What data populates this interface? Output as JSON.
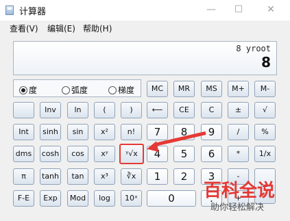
{
  "window": {
    "title": "计算器",
    "minimize_glyph": "—",
    "maximize_glyph": "☐",
    "close_glyph": "✕"
  },
  "menu": [
    "查看(V)",
    "编辑(E)",
    "帮助(H)"
  ],
  "display": {
    "expression": "8 yroot",
    "value": "8"
  },
  "angle_modes": [
    {
      "label": "度",
      "selected": true
    },
    {
      "label": "弧度",
      "selected": false
    },
    {
      "label": "梯度",
      "selected": false
    }
  ],
  "keys": {
    "mc": "MC",
    "mr": "MR",
    "ms": "MS",
    "mplus": "M+",
    "mminus": "M-",
    "inv": "Inv",
    "ln": "ln",
    "lparen": "(",
    "rparen": ")",
    "backspace": "⟵",
    "ce": "CE",
    "c": "C",
    "plusminus": "±",
    "sqrt": "√",
    "int": "Int",
    "sinh": "sinh",
    "sin": "sin",
    "x2": "x²",
    "fact": "n!",
    "seven": "7",
    "eight": "8",
    "nine": "9",
    "divide": "/",
    "percent": "%",
    "dms": "dms",
    "cosh": "cosh",
    "cos": "cos",
    "xy": "xʸ",
    "yroot": "ʸ√x",
    "four": "4",
    "five": "5",
    "six": "6",
    "multiply": "*",
    "reciprocal": "1/x",
    "pi": "π",
    "tanh": "tanh",
    "tan": "tan",
    "x3": "x³",
    "cuberoot": "∛x",
    "one": "1",
    "two": "2",
    "three": "3",
    "minus": "-",
    "equals": "=",
    "fe": "F-E",
    "exp": "Exp",
    "mod": "Mod",
    "log": "log",
    "tenx": "10ˣ",
    "zero": "0",
    "dot": ".",
    "plus": "+"
  },
  "watermark": {
    "main": "百科全说",
    "sub": "助你轻松解决"
  },
  "colors": {
    "highlight": "#e53935",
    "display_border": "#a7b4c2"
  }
}
